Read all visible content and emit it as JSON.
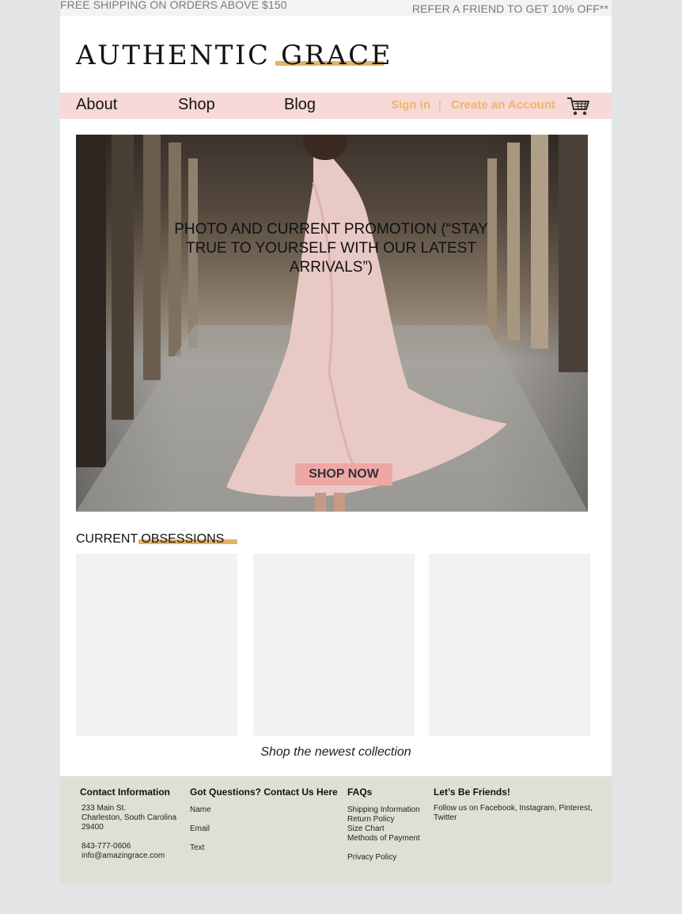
{
  "topbar": {
    "shipping_promo": "FREE SHIPPING ON ORDERS ABOVE $150",
    "referral_promo": "REFER A FRIEND TO GET 10% OFF**"
  },
  "brand": {
    "logo_text": "AUTHENTIC GRACE",
    "accent_color": "#e3b365",
    "nav_bg_color": "#f7d9d8"
  },
  "nav": {
    "items": [
      {
        "label": "About"
      },
      {
        "label": "Shop"
      },
      {
        "label": "Blog"
      }
    ],
    "sign_in": "Sign in",
    "separator": "|",
    "create_account": "Create an Account",
    "cart_icon": "shopping-cart-icon"
  },
  "hero": {
    "promo_text": "PHOTO AND CURRENT PROMOTION (“STAY TRUE TO YOURSELF WITH OUR LATEST ARRIVALS”)",
    "cta_label": "SHOP NOW",
    "cta_color": "#eea7a4"
  },
  "obsessions": {
    "title": "CURRENT OBSESSIONS",
    "link": "Shop the newest collection"
  },
  "footer": {
    "contact": {
      "heading": "Contact Information",
      "address_line1": "233 Main St.",
      "address_line2": "Charleston, South Carolina",
      "address_line3": "29400",
      "phone": "843-777-0606",
      "email": "info@amazingrace.com"
    },
    "questions": {
      "heading": "Got Questions? Contact Us Here",
      "name_label": "Name",
      "email_label": "Email",
      "text_label": "Text"
    },
    "faqs": {
      "heading": "FAQs",
      "links": [
        "Shipping Information",
        "Return Policy",
        "Size Chart",
        "Methods of Payment"
      ],
      "privacy": "Privacy Policy"
    },
    "social": {
      "heading": "Let’s Be Friends!",
      "text": "Follow us on Facebook, Instagram, Pinterest, Twitter"
    }
  }
}
